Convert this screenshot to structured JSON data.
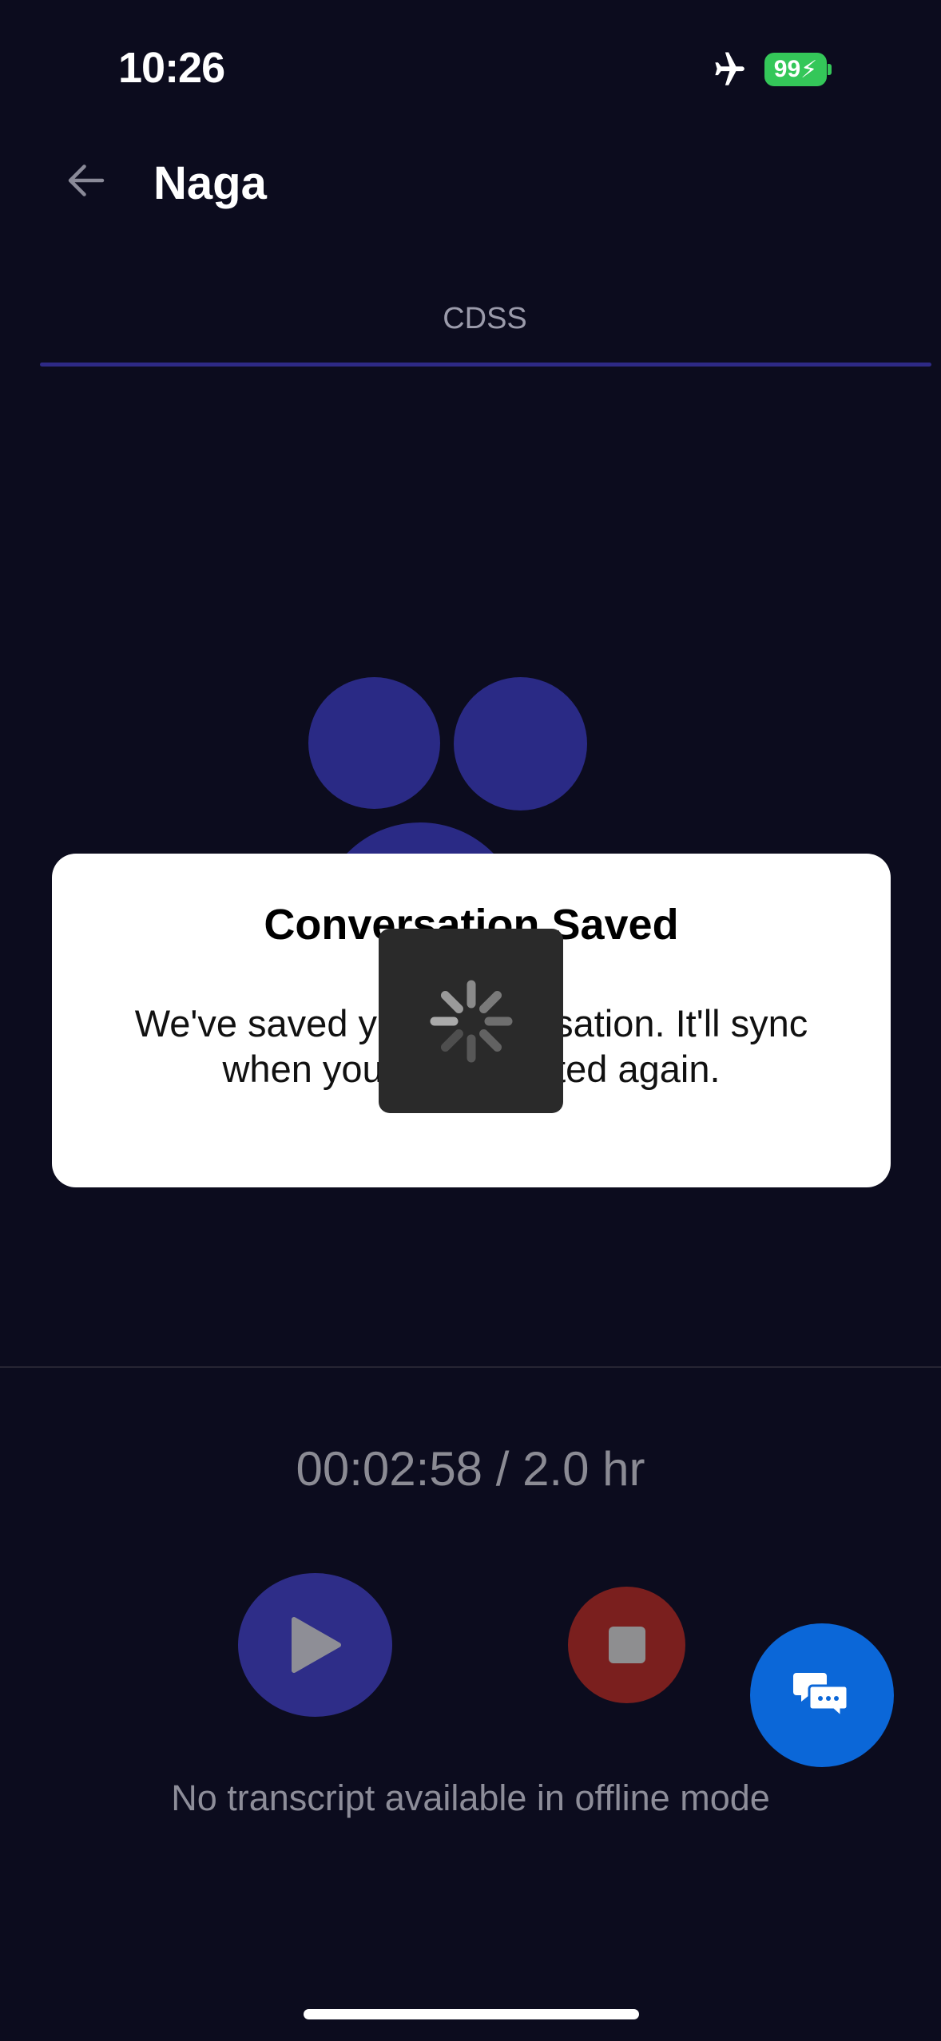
{
  "status_bar": {
    "time": "10:26",
    "battery": "99"
  },
  "header": {
    "title": "Naga"
  },
  "tabs": [
    {
      "label": "CDSS"
    }
  ],
  "recording": {
    "timer": "00:02:58 / 2.0 hr"
  },
  "transcript": {
    "empty_message": "No transcript available in offline mode"
  },
  "dialog": {
    "title": "Conversation Saved",
    "message": "We've saved your conversation. It'll sync when you're connected again."
  },
  "colors": {
    "background": "#0c0c1e",
    "accent": "#2a2a85",
    "stop": "#7a1f1e",
    "chat": "#0b67d8",
    "battery": "#34c759"
  },
  "icons": [
    "airplane-icon",
    "battery-icon",
    "back-arrow-icon",
    "play-icon",
    "stop-icon",
    "chat-icon",
    "spinner-icon"
  ]
}
